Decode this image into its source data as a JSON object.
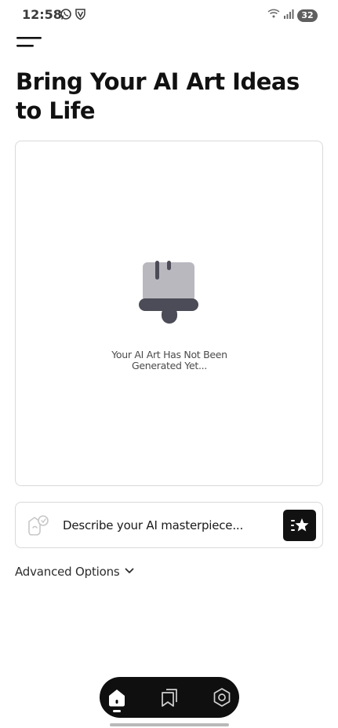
{
  "status_bar": {
    "time": "12:58",
    "left_icons": [
      "whatsapp-icon",
      "vpn-shield-icon"
    ],
    "right_icons": [
      "wifi-icon",
      "signal-icon"
    ],
    "battery_level": "32"
  },
  "header": {
    "menu_icon": "hamburger-menu-icon",
    "title": "Bring Your AI Art Ideas to Life"
  },
  "preview": {
    "placeholder_icon": "paint-brush-icon",
    "message": "Your AI Art Has Not Been Generated Yet..."
  },
  "prompt": {
    "icon": "art-prompt-icon",
    "placeholder": "Describe your AI masterpiece...",
    "value": "",
    "generate_icon": "sparkle-generate-icon"
  },
  "advanced_options": {
    "label": "Advanced Options",
    "icon": "chevron-down-icon"
  },
  "bottom_nav": {
    "items": [
      {
        "name": "home",
        "icon": "home-icon",
        "active": true
      },
      {
        "name": "gallery",
        "icon": "gallery-icon",
        "active": false
      },
      {
        "name": "settings",
        "icon": "settings-icon",
        "active": false
      }
    ]
  },
  "colors": {
    "background": "#ffffff",
    "accent": "#111111",
    "border": "#d9d9d9",
    "illustration_light": "#b9b8bf",
    "illustration_dark": "#4b4c57"
  }
}
